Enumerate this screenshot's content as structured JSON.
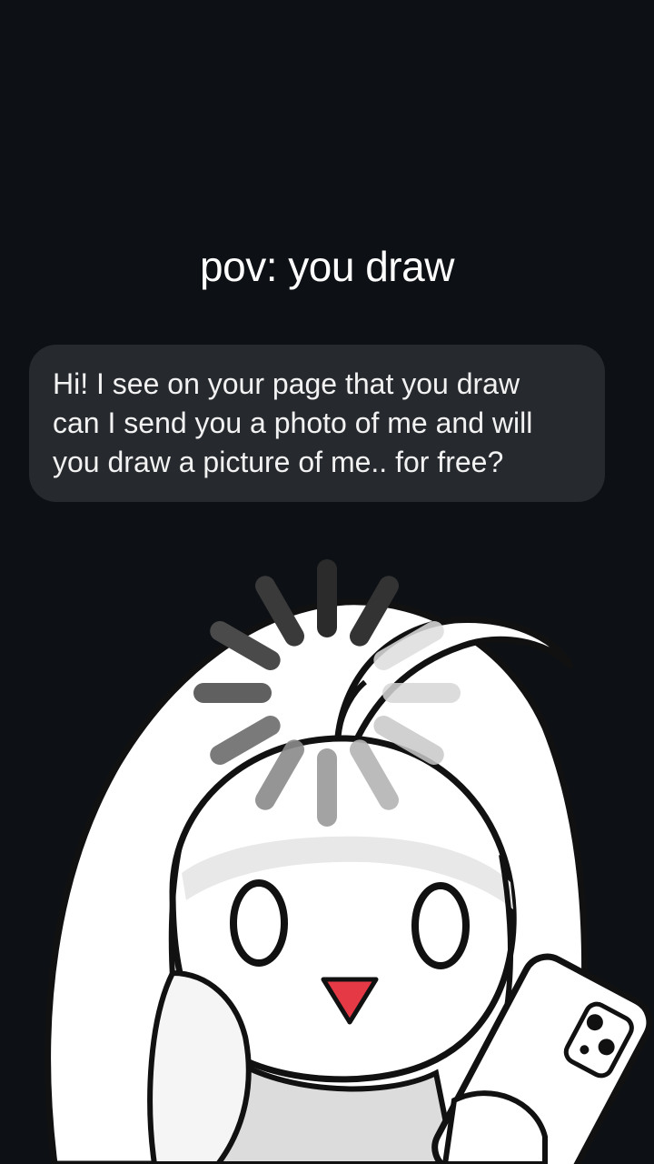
{
  "caption": {
    "text": "pov: you draw"
  },
  "message": {
    "lines": [
      "Hi! I see on your page that you draw",
      "can I send you a photo of me and will",
      "you draw a picture of me.. for free?"
    ]
  },
  "artwork": {
    "subject": "cartoon girl with long white hair holding a phone",
    "icon": "cartoon-character-illustration"
  },
  "loading": {
    "icon": "loading-spinner-icon"
  },
  "colors": {
    "background": "#0d1014",
    "bubble": "#26292e",
    "text": "#ffffff",
    "nose": "#e63946"
  }
}
